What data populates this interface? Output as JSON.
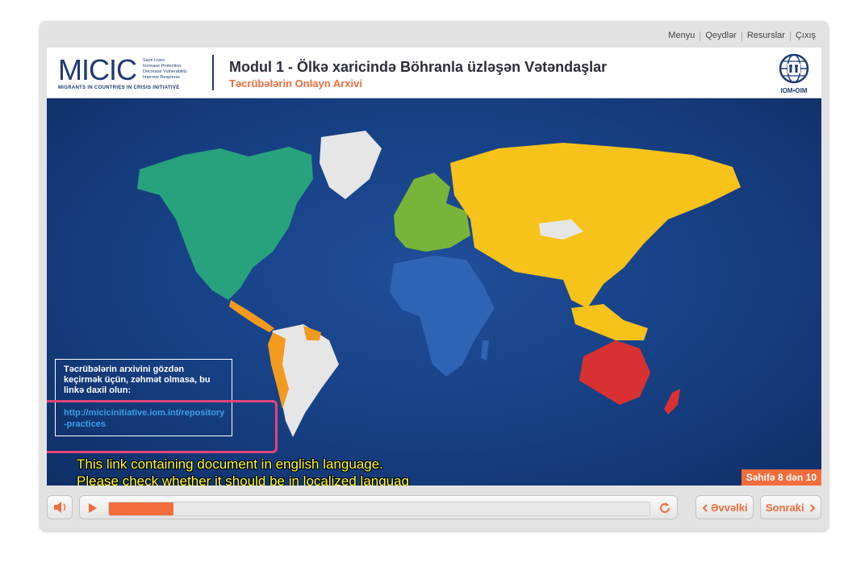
{
  "topnav": [
    "Menyu",
    "Qeydlər",
    "Resurslar",
    "Çıxış"
  ],
  "logo": {
    "word": "MICIC",
    "tags": [
      "Save Lives",
      "Increase Protection",
      "Decrease Vulnerability",
      "Improve Response"
    ],
    "sub": "MIGRANTS IN COUNTRIES IN CRISIS INITIATIVE"
  },
  "header": {
    "title": "Modul 1 - Ölkə xaricində Böhranla üzləşən Vətəndaşlar",
    "subtitle": "Təcrübələrin Onlayn Arxivi"
  },
  "iom_label": "IOM•OIM",
  "infobox": {
    "text": "Təcrübələrin arxivini gözdən keçirmək üçün, zəhmət olmasa, bu linkə daxil olun:",
    "link": "http://micicinitiative.iom.int/repository-practices"
  },
  "note": {
    "line1": "This link containing document in english language.",
    "line2": "Please check whether it should be in localized languag"
  },
  "page_badge": "Səhifə 8 dən 10",
  "progress": 0.12,
  "nav": {
    "prev": "Əvvəlki",
    "next": "Sonraki"
  },
  "colors": {
    "accent": "#f26c3c",
    "brand": "#1f3b73",
    "map_bg": "#163f82"
  },
  "icons": [
    "speaker-icon",
    "play-icon",
    "reload-icon",
    "chevron-left-icon",
    "chevron-right-icon",
    "iom-globe-icon"
  ]
}
